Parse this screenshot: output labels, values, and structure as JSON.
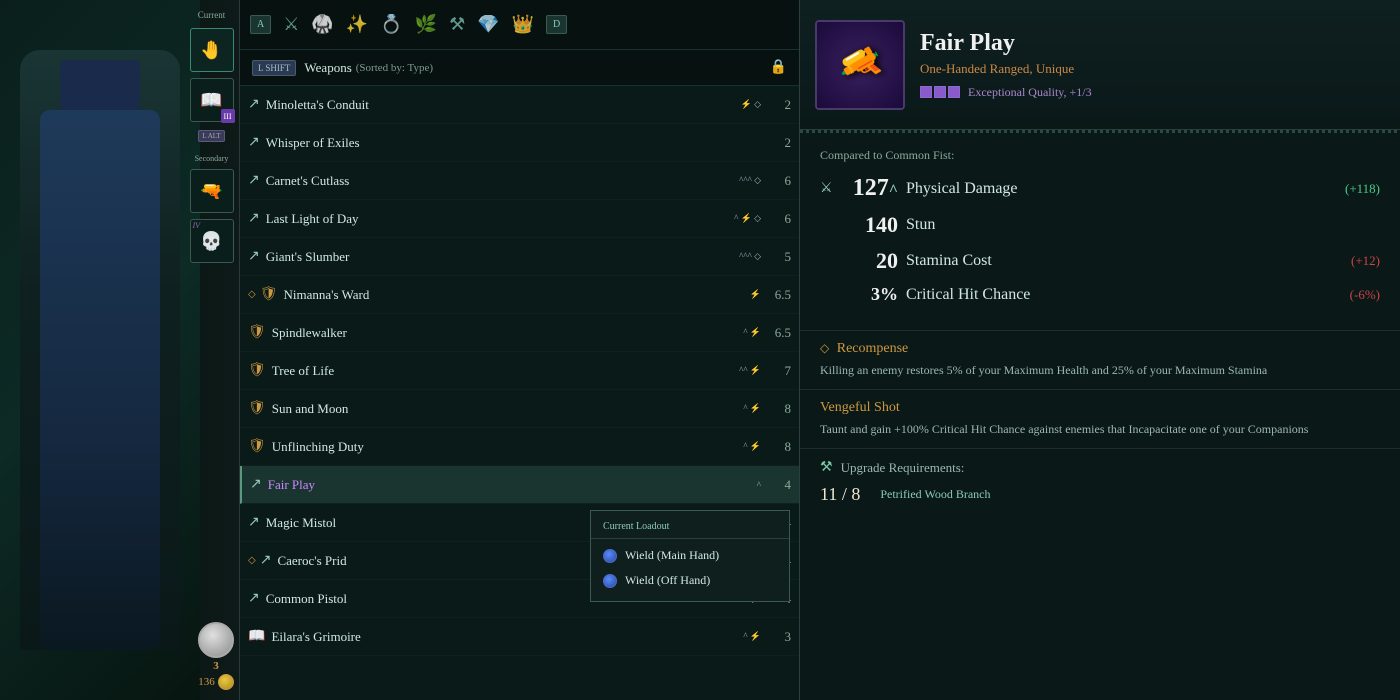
{
  "character": {
    "current_label": "Current",
    "secondary_label": "Secondary",
    "lalt_label": "L ALT",
    "slot_iv": "IV",
    "resource_count": "3",
    "coin_count": "136"
  },
  "inventory": {
    "tab_a": "A",
    "tab_d": "D",
    "lshift_label": "L SHIFT",
    "category_label": "Weapons",
    "sort_label": "(Sorted by: Type)",
    "items": [
      {
        "name": "Minoletta's Conduit",
        "icon": "⚔",
        "type": "weapon",
        "enchants": "⚡◇",
        "weight": "2"
      },
      {
        "name": "Whisper of Exiles",
        "icon": "⚔",
        "type": "weapon",
        "enchants": "",
        "weight": "2"
      },
      {
        "name": "Carnet's Cutlass",
        "icon": "⚔",
        "type": "weapon",
        "enchants": "^^^◇",
        "weight": "6"
      },
      {
        "name": "Last Light of Day",
        "icon": "⚔",
        "type": "weapon",
        "enchants": "^⚡◇",
        "weight": "6"
      },
      {
        "name": "Giant's Slumber",
        "icon": "⚔",
        "type": "weapon",
        "enchants": "^^^◇",
        "weight": "5"
      },
      {
        "name": "Nimanna's Ward",
        "icon": "🛡",
        "type": "shield",
        "enchants": "⚡",
        "weight": "6.5",
        "diamond": true
      },
      {
        "name": "Spindlewalker",
        "icon": "🛡",
        "type": "shield",
        "enchants": "^⚡",
        "weight": "6.5"
      },
      {
        "name": "Tree of Life",
        "icon": "🛡",
        "type": "shield",
        "enchants": "^^⚡",
        "weight": "7"
      },
      {
        "name": "Sun and Moon",
        "icon": "🛡",
        "type": "shield",
        "enchants": "^⚡",
        "weight": "8"
      },
      {
        "name": "Unflinching Duty",
        "icon": "🛡",
        "type": "shield",
        "enchants": "^⚡",
        "weight": "8"
      },
      {
        "name": "Fair Play",
        "icon": "⚔",
        "type": "weapon",
        "enchants": "^",
        "weight": "4",
        "selected": true,
        "purple": true
      },
      {
        "name": "Magic Mistol",
        "icon": "⚔",
        "type": "weapon",
        "enchants": "",
        "weight": "4",
        "partial": true
      },
      {
        "name": "Caeroc's Prid",
        "icon": "⚔",
        "type": "weapon",
        "enchants": "",
        "weight": "4",
        "partial": true,
        "diamond": true
      },
      {
        "name": "Common Pistol",
        "icon": "⚔",
        "type": "weapon",
        "enchants": "⚡",
        "weight": "4"
      },
      {
        "name": "Eilara's Grimoire",
        "icon": "📖",
        "type": "grimoire",
        "enchants": "^⚡",
        "weight": "3"
      }
    ]
  },
  "context_menu": {
    "title": "Current Loadout",
    "options": [
      {
        "label": "Wield (Main Hand)"
      },
      {
        "label": "Wield (Off Hand)"
      }
    ]
  },
  "detail": {
    "item_name": "Fair Play",
    "item_type": "One-Handed Ranged, Unique",
    "quality_text": "Exceptional Quality, +1/3",
    "quality_pips": 3,
    "quality_filled": 3,
    "compare_label": "Compared to Common Fist:",
    "stats": [
      {
        "value": "127",
        "caret": "^",
        "name": "Physical Damage",
        "diff": "+118",
        "diff_type": "pos"
      },
      {
        "value": "140",
        "name": "Stun",
        "diff": "",
        "diff_type": ""
      },
      {
        "value": "20",
        "name": "Stamina Cost",
        "diff": "+12",
        "diff_type": "neg"
      },
      {
        "value": "3%",
        "name": "Critical Hit Chance",
        "diff": "-6%",
        "diff_type": "neg"
      }
    ],
    "abilities": [
      {
        "name": "Recompense",
        "description": "Killing an enemy restores 5% of your Maximum Health and 25% of your Maximum Stamina",
        "diamond": true
      },
      {
        "name": "Vengeful Shot",
        "description": "Taunt and gain +100% Critical Hit Chance against enemies that Incapacitate one of your Companions",
        "diamond": false
      }
    ],
    "upgrade_label": "Upgrade Requirements:",
    "upgrade_values": "11 / 8",
    "upgrade_resource": "Petrified Wood Branch"
  }
}
